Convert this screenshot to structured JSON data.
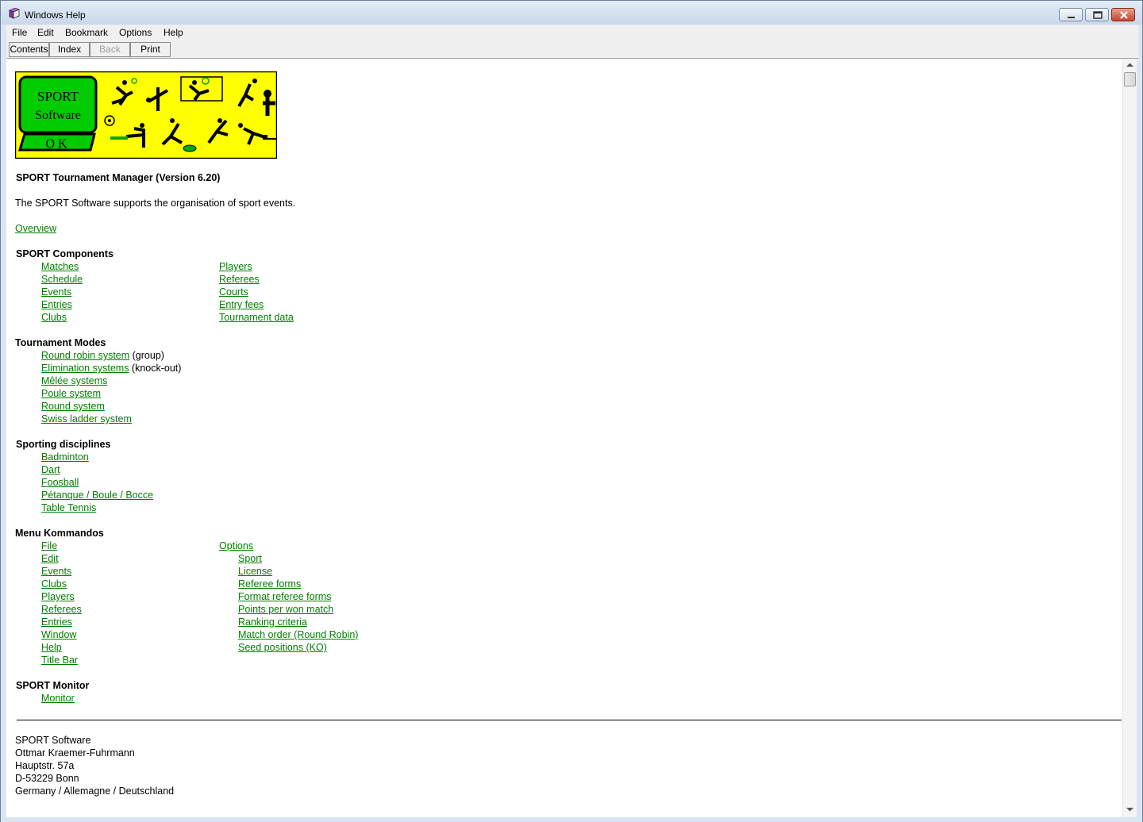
{
  "window": {
    "title": "Windows Help"
  },
  "menu": [
    "File",
    "Edit",
    "Bookmark",
    "Options",
    "Help"
  ],
  "toolbar": {
    "contents": "Contents",
    "index": "Index",
    "back": "Back",
    "print": "Print"
  },
  "logo": {
    "line1": "SPORT",
    "line2": "Software",
    "line3": "O K"
  },
  "heading": "SPORT Tournament Manager (Version 6.20)",
  "intro": "The SPORT Software supports the organisation of sport events.",
  "overview_link": "Overview",
  "components": {
    "title": "SPORT Components",
    "col1": [
      "Matches",
      "Schedule",
      "Events",
      "Entries",
      "Clubs"
    ],
    "col2": [
      "Players",
      "Referees",
      "Courts",
      "Entry fees",
      "Tournament data"
    ]
  },
  "modes": {
    "title": "Tournament Modes",
    "items": [
      {
        "link": "Round robin system",
        "suffix": " (group)"
      },
      {
        "link": "Elimination systems",
        "suffix": " (knock-out)"
      },
      {
        "link": "Mêlée systems",
        "suffix": ""
      },
      {
        "link": "Poule system",
        "suffix": ""
      },
      {
        "link": "Round system",
        "suffix": ""
      },
      {
        "link": "Swiss ladder system",
        "suffix": ""
      }
    ]
  },
  "disciplines": {
    "title": "Sporting disciplines",
    "items": [
      "Badminton",
      "Dart",
      "Foosball",
      "Pétanque / Boule / Bocce",
      "Table Tennis"
    ]
  },
  "menu_kommandos": {
    "title": "Menu Kommandos",
    "col1": [
      "File",
      "Edit",
      "Events",
      "Clubs",
      "Players",
      "Referees",
      "Entries",
      "Window",
      "Help",
      "Title Bar"
    ],
    "options_label": "Options",
    "options_sub": [
      "Sport",
      "License",
      "Referee forms",
      "Format referee forms",
      "Points per won match",
      "Ranking criteria",
      "Match order (Round Robin)",
      "Seed positions (KO)"
    ]
  },
  "monitor": {
    "title": "SPORT Monitor",
    "items": [
      "Monitor"
    ]
  },
  "address": [
    "SPORT Software",
    "Ottmar Kraemer-Fuhrmann",
    "Hauptstr. 57a",
    "D-53229 Bonn",
    "Germany / Allemagne / Deutschland"
  ],
  "colors": {
    "link": "#008000",
    "logo_bg": "#ffff00",
    "logo_green": "#00cc00"
  }
}
